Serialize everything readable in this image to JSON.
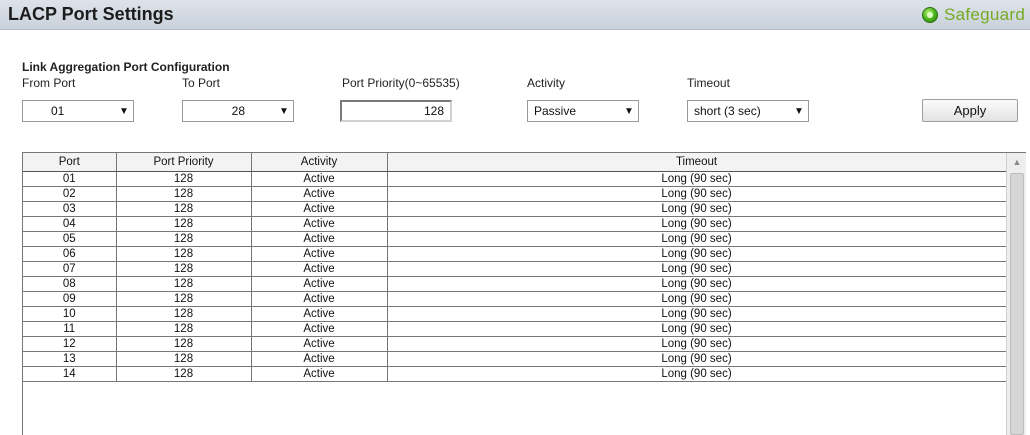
{
  "header": {
    "title": "LACP Port Settings",
    "safeguard_label": "Safeguard",
    "safeguard_icon": "status-led-icon"
  },
  "config": {
    "section_title": "Link Aggregation Port Configuration",
    "from_port_label": "From Port",
    "to_port_label": "To Port",
    "priority_label": "Port Priority(0~65535)",
    "activity_label": "Activity",
    "timeout_label": "Timeout",
    "from_port_value": "01",
    "to_port_value": "28",
    "priority_value": "128",
    "activity_value": "Passive",
    "timeout_value": "short (3 sec)",
    "apply_label": "Apply"
  },
  "table": {
    "headers": [
      "Port",
      "Port Priority",
      "Activity",
      "Timeout"
    ],
    "rows": [
      [
        "01",
        "128",
        "Active",
        "Long (90 sec)"
      ],
      [
        "02",
        "128",
        "Active",
        "Long (90 sec)"
      ],
      [
        "03",
        "128",
        "Active",
        "Long (90 sec)"
      ],
      [
        "04",
        "128",
        "Active",
        "Long (90 sec)"
      ],
      [
        "05",
        "128",
        "Active",
        "Long (90 sec)"
      ],
      [
        "06",
        "128",
        "Active",
        "Long (90 sec)"
      ],
      [
        "07",
        "128",
        "Active",
        "Long (90 sec)"
      ],
      [
        "08",
        "128",
        "Active",
        "Long (90 sec)"
      ],
      [
        "09",
        "128",
        "Active",
        "Long (90 sec)"
      ],
      [
        "10",
        "128",
        "Active",
        "Long (90 sec)"
      ],
      [
        "11",
        "128",
        "Active",
        "Long (90 sec)"
      ],
      [
        "12",
        "128",
        "Active",
        "Long (90 sec)"
      ],
      [
        "13",
        "128",
        "Active",
        "Long (90 sec)"
      ],
      [
        "14",
        "128",
        "Active",
        "Long (90 sec)"
      ]
    ]
  },
  "colors": {
    "safeguard_text": "#77aa22",
    "status_led": "#4bb51f"
  }
}
